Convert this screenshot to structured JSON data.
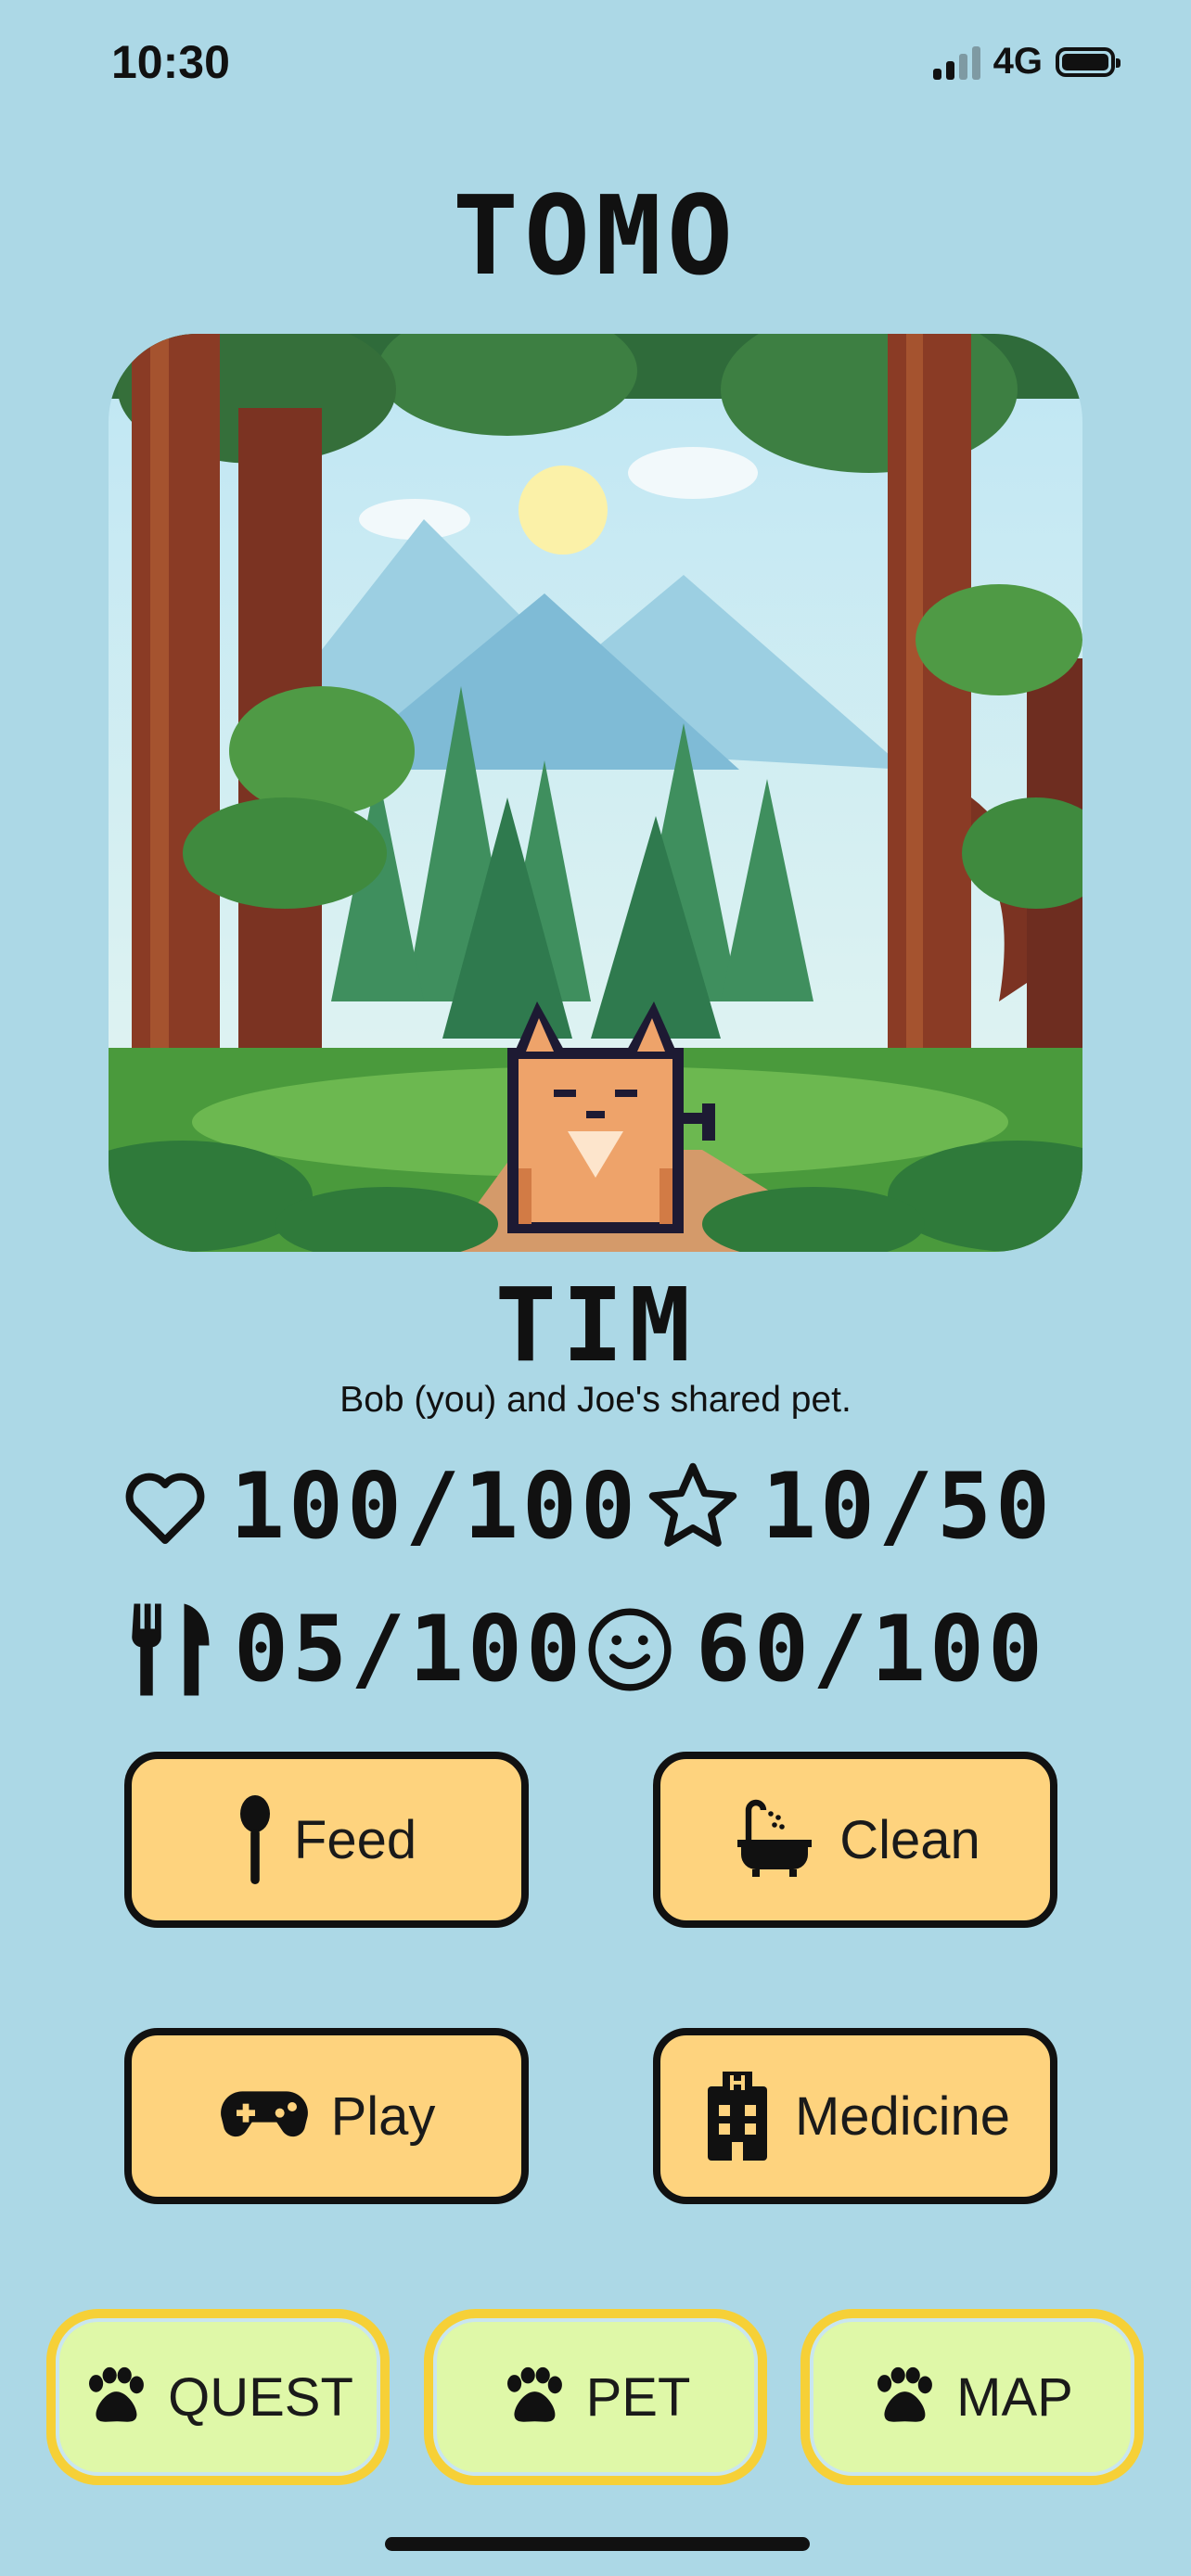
{
  "status_bar": {
    "time": "10:30",
    "network": "4G"
  },
  "app": {
    "title": "TOMO"
  },
  "pet": {
    "name": "TIM",
    "subtitle": "Bob (you) and Joe's shared pet."
  },
  "stats": {
    "health": "100/100",
    "stars": "10/50",
    "hunger": "05/100",
    "happiness": "60/100"
  },
  "actions": {
    "feed": "Feed",
    "clean": "Clean",
    "play": "Play",
    "medicine": "Medicine"
  },
  "nav": {
    "quest": "QUEST",
    "pet": "PET",
    "map": "MAP"
  },
  "colors": {
    "background": "#acd8e6",
    "action_button": "#fed37e",
    "nav_button": "#dff8a8",
    "nav_border": "#f6d037"
  },
  "icons": {
    "health": "heart-outline-icon",
    "stars": "star-outline-icon",
    "hunger": "fork-knife-icon",
    "happiness": "smiley-icon",
    "feed": "spoon-icon",
    "clean": "bathtub-icon",
    "play": "gamepad-icon",
    "medicine": "hospital-icon",
    "nav": "paw-icon"
  }
}
